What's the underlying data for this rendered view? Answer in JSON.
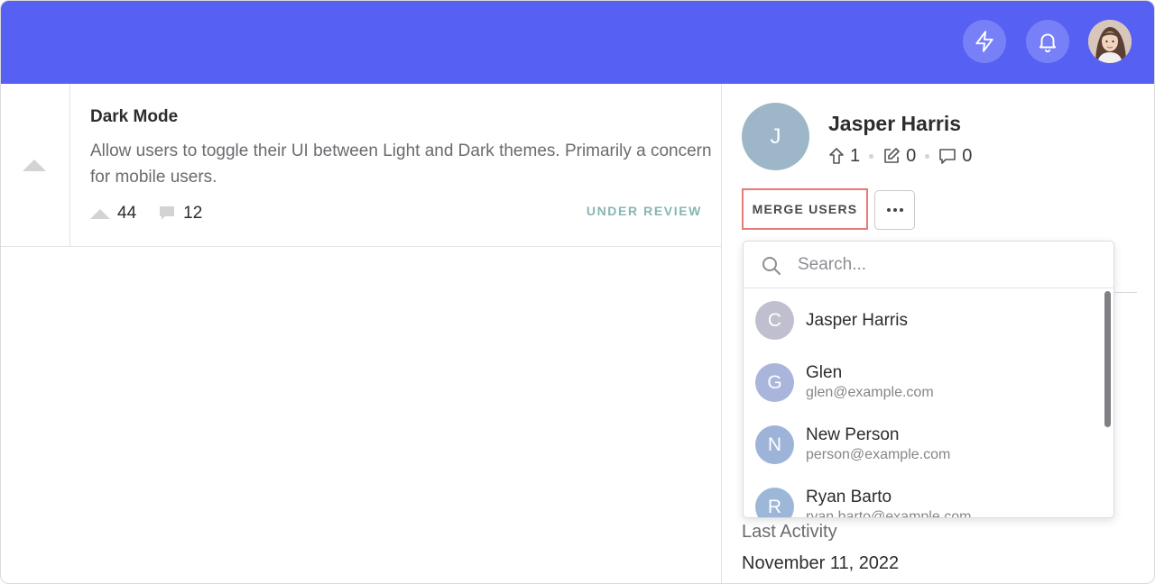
{
  "colors": {
    "header_bg": "#5661f4",
    "accent_status": "#87b5b5",
    "merge_border": "#e77a74"
  },
  "header": {
    "actions": [
      {
        "icon": "bolt-icon"
      },
      {
        "icon": "bell-icon"
      },
      {
        "icon": "profile-avatar"
      }
    ]
  },
  "post": {
    "title": "Dark Mode",
    "description": "Allow users to toggle their UI between Light and Dark themes. Primarily a concern for mobile users.",
    "votes": "44",
    "comments": "12",
    "status": "UNDER REVIEW"
  },
  "user": {
    "initial": "J",
    "name": "Jasper Harris",
    "stats": {
      "upvotes": "1",
      "posts": "0",
      "comments": "0"
    },
    "merge_label": "MERGE USERS",
    "last_activity_label": "Last Activity",
    "last_activity_value": "November 11, 2022"
  },
  "merge_dropdown": {
    "search_placeholder": "Search...",
    "users": [
      {
        "initial": "C",
        "name": "Jasper Harris",
        "email": "",
        "color": "#c0bfcf"
      },
      {
        "initial": "G",
        "name": "Glen",
        "email": "glen@example.com",
        "color": "#a9b5da"
      },
      {
        "initial": "N",
        "name": "New Person",
        "email": "person@example.com",
        "color": "#9db4d8"
      },
      {
        "initial": "R",
        "name": "Ryan Barto",
        "email": "ryan.barto@example.com",
        "color": "#9db7d9"
      }
    ]
  }
}
